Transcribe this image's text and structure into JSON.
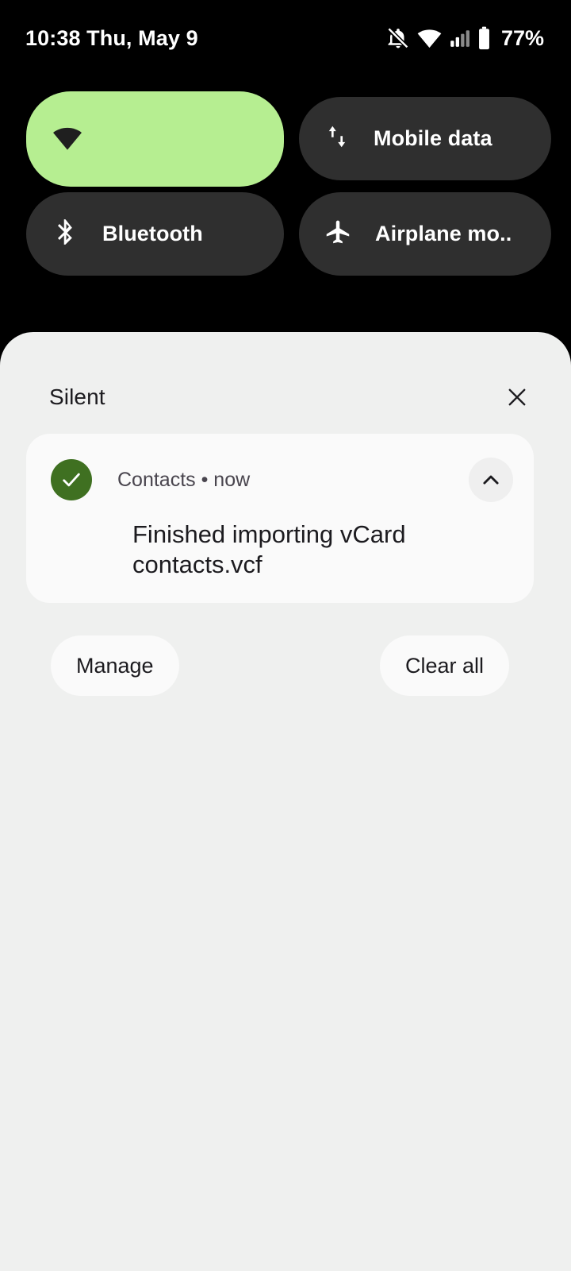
{
  "status_bar": {
    "clock": "10:38 Thu, May 9",
    "battery_percent": "77%",
    "icons": [
      {
        "name": "notifications-off-icon"
      },
      {
        "name": "wifi-icon"
      },
      {
        "name": "cell-signal-icon"
      },
      {
        "name": "battery-icon"
      }
    ]
  },
  "quick_settings": {
    "tiles": [
      {
        "label": "",
        "icon": "wifi-icon",
        "active": true,
        "name": "qs-tile-wifi"
      },
      {
        "label": "Mobile data",
        "icon": "mobile-data-icon",
        "active": false,
        "name": "qs-tile-mobile-data"
      },
      {
        "label": "Bluetooth",
        "icon": "bluetooth-icon",
        "active": false,
        "name": "qs-tile-bluetooth"
      },
      {
        "label": "Airplane mo..",
        "icon": "airplane-icon",
        "active": false,
        "name": "qs-tile-airplane-mode"
      }
    ],
    "active_tile_color": "#b6ee91",
    "inactive_tile_color": "#2f2f2f"
  },
  "shade": {
    "section_title": "Silent",
    "close_label": "Close",
    "background_color": "#eff0ef",
    "notification": {
      "app_name": "Contacts",
      "separator": "•",
      "time": "now",
      "header_text": "Contacts • now",
      "title": "Finished importing vCard contacts.vcf",
      "app_icon_color": "#3f7021",
      "app_icon": "check-circle-icon",
      "expand_icon": "chevron-up-icon"
    },
    "manage_label": "Manage",
    "clear_all_label": "Clear all"
  }
}
